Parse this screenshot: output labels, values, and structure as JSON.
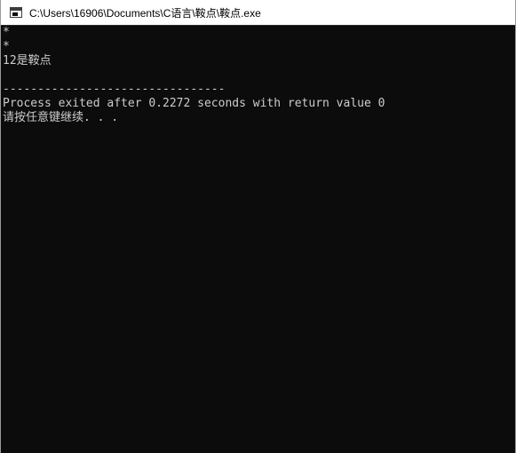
{
  "window": {
    "title": "C:\\Users\\16906\\Documents\\C语言\\鞍点\\鞍点.exe"
  },
  "console": {
    "lines": [
      "*",
      "*",
      "12是鞍点",
      "",
      "--------------------------------",
      "Process exited after 0.2272 seconds with return value 0",
      "请按任意键继续. . ."
    ]
  },
  "colors": {
    "console_bg": "#0c0c0c",
    "console_fg": "#cccccc",
    "titlebar_bg": "#ffffff"
  },
  "icons": {
    "app_icon": "console-window-icon"
  }
}
